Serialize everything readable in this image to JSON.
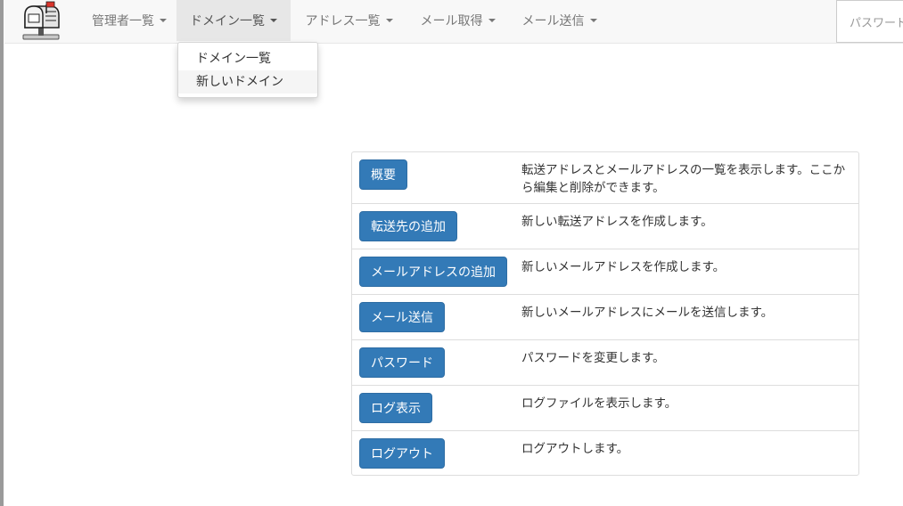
{
  "navbar": {
    "items": [
      {
        "label": "管理者一覧"
      },
      {
        "label": "ドメイン一覧"
      },
      {
        "label": "アドレス一覧"
      },
      {
        "label": "メール取得"
      },
      {
        "label": "メール送信"
      }
    ],
    "password_label": "パスワード"
  },
  "dropdown": {
    "items": [
      {
        "label": "ドメイン一覧"
      },
      {
        "label": "新しいドメイン"
      }
    ]
  },
  "rows": [
    {
      "button": "概要",
      "description": "転送アドレスとメールアドレスの一覧を表示します。ここから編集と削除ができます。"
    },
    {
      "button": "転送先の追加",
      "description": "新しい転送アドレスを作成します。"
    },
    {
      "button": "メールアドレスの追加",
      "description": "新しいメールアドレスを作成します。"
    },
    {
      "button": "メール送信",
      "description": "新しいメールアドレスにメールを送信します。"
    },
    {
      "button": "パスワード",
      "description": "パスワードを変更します。"
    },
    {
      "button": "ログ表示",
      "description": "ログファイルを表示します。"
    },
    {
      "button": "ログアウト",
      "description": "ログアウトします。"
    }
  ],
  "colors": {
    "primary": "#337ab7",
    "navbar_bg": "#f8f8f8",
    "active_nav_bg": "#e7e7e7"
  },
  "icons": {
    "logo": "mailbox-icon",
    "caret": "caret-down-icon"
  }
}
